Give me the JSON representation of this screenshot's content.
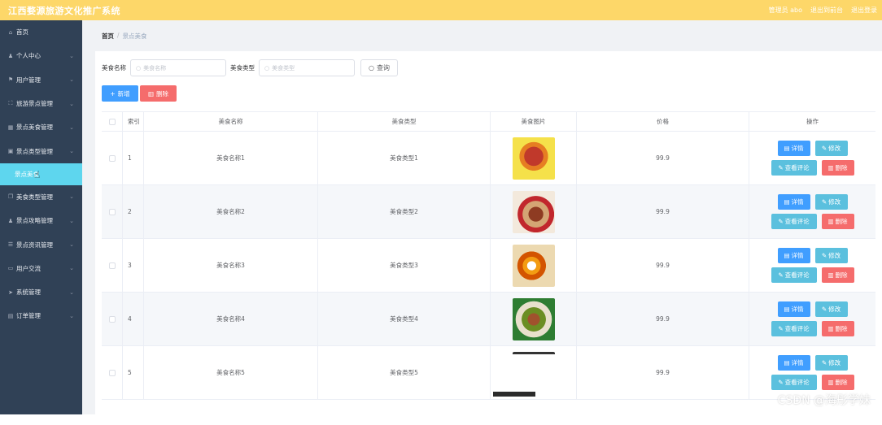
{
  "header": {
    "title": "江西婺源旅游文化推广系统",
    "admin": "管理员 abo",
    "back": "退出到前台",
    "logout": "退出登录"
  },
  "sidebar": {
    "items": [
      {
        "label": "首页",
        "icon": "home-icon",
        "glyph": "⌂",
        "arrow": false
      },
      {
        "label": "个人中心",
        "icon": "user-icon",
        "glyph": "♟",
        "arrow": true
      },
      {
        "label": "用户管理",
        "icon": "flag-icon",
        "glyph": "⚑",
        "arrow": true
      },
      {
        "label": "旅游景点管理",
        "icon": "fullscreen-icon",
        "glyph": "⛶",
        "arrow": true
      },
      {
        "label": "景点美食管理",
        "icon": "grid-icon",
        "glyph": "▦",
        "arrow": true
      },
      {
        "label": "景点类型管理",
        "icon": "picture-icon",
        "glyph": "▣",
        "arrow": true
      }
    ],
    "sub": {
      "label": "景点美食"
    },
    "items2": [
      {
        "label": "美食类型管理",
        "icon": "copy-icon",
        "glyph": "❐",
        "arrow": true
      },
      {
        "label": "景点攻略管理",
        "icon": "user-icon",
        "glyph": "♟",
        "arrow": true
      },
      {
        "label": "景点资讯管理",
        "icon": "list-icon",
        "glyph": "☰",
        "arrow": true
      },
      {
        "label": "用户交流",
        "icon": "chat-icon",
        "glyph": "▭",
        "arrow": true
      },
      {
        "label": "系统管理",
        "icon": "send-icon",
        "glyph": "➤",
        "arrow": true
      },
      {
        "label": "订单管理",
        "icon": "order-icon",
        "glyph": "▤",
        "arrow": true
      }
    ]
  },
  "breadcrumb": {
    "home": "首页",
    "sep": "/",
    "current": "景点美食"
  },
  "search": {
    "name_label": "美食名称",
    "name_placeholder": "美食名称",
    "type_label": "美食类型",
    "type_placeholder": "美食类型",
    "query": "查询"
  },
  "toolbar": {
    "add": "新增",
    "delete": "删除"
  },
  "table": {
    "headers": [
      "索引",
      "美食名称",
      "美食类型",
      "美食图片",
      "价格",
      "操作"
    ],
    "rows": [
      {
        "index": "1",
        "name": "美食名称1",
        "type": "美食类型1",
        "price": "99.9"
      },
      {
        "index": "2",
        "name": "美食名称2",
        "type": "美食类型2",
        "price": "99.9"
      },
      {
        "index": "3",
        "name": "美食名称3",
        "type": "美食类型3",
        "price": "99.9"
      },
      {
        "index": "4",
        "name": "美食名称4",
        "type": "美食类型4",
        "price": "99.9"
      },
      {
        "index": "5",
        "name": "美食名称5",
        "type": "美食类型5",
        "price": "99.9"
      }
    ],
    "ops": {
      "detail": "详情",
      "edit": "修改",
      "review": "查看评论",
      "remove": "删除"
    }
  },
  "watermark": "CSDN @海彤学妹"
}
